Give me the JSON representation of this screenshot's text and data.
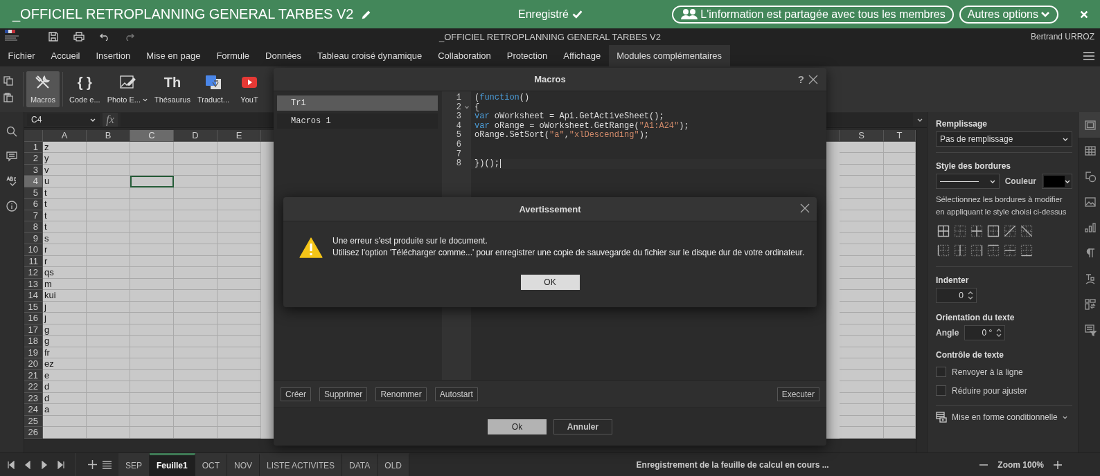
{
  "top_bar": {
    "title": "_OFFICIEL RETROPLANNING GENERAL TARBES V2",
    "status": "Enregistré",
    "share_button": "L'information est partagée avec tous les membres",
    "options_button": "Autres options"
  },
  "title_bar": {
    "title": "_OFFICIEL RETROPLANNING GENERAL TARBES V2",
    "user": "Bertrand URROZ"
  },
  "menu_tabs": [
    {
      "label": "Fichier",
      "selected": false
    },
    {
      "label": "Accueil",
      "selected": false
    },
    {
      "label": "Insertion",
      "selected": false
    },
    {
      "label": "Mise en page",
      "selected": false
    },
    {
      "label": "Formule",
      "selected": false
    },
    {
      "label": "Données",
      "selected": false
    },
    {
      "label": "Tableau croisé dynamique",
      "selected": false
    },
    {
      "label": "Collaboration",
      "selected": false
    },
    {
      "label": "Protection",
      "selected": false
    },
    {
      "label": "Affichage",
      "selected": false
    },
    {
      "label": "Modules complémentaires",
      "selected": true
    }
  ],
  "ribbon": [
    {
      "label": "Macros",
      "kind": "tools",
      "selected": true,
      "dropdown": false
    },
    {
      "label": "Code e...",
      "kind": "glyph",
      "glyph": "{ }",
      "selected": false,
      "dropdown": false
    },
    {
      "label": "Photo E...",
      "kind": "photo",
      "selected": false,
      "dropdown": true
    },
    {
      "label": "Thésaurus",
      "kind": "glyph",
      "glyph": "Th",
      "selected": false,
      "dropdown": false
    },
    {
      "label": "Traduct...",
      "kind": "translate",
      "selected": false,
      "dropdown": false
    },
    {
      "label": "YouT",
      "kind": "video",
      "selected": false,
      "dropdown": false
    }
  ],
  "formula_bar": {
    "name_box": "C4",
    "function_glyph": "fx"
  },
  "sheet": {
    "columns_left": [
      {
        "label": "A",
        "selected": false
      },
      {
        "label": "B",
        "selected": false
      },
      {
        "label": "C",
        "selected": true
      },
      {
        "label": "D",
        "selected": false
      },
      {
        "label": "E",
        "selected": false
      }
    ],
    "columns_right": [
      {
        "label": "S",
        "selected": false
      },
      {
        "label": "T",
        "selected": false
      }
    ],
    "rows": [
      {
        "number": "1",
        "selected": false,
        "cells": [
          "z"
        ]
      },
      {
        "number": "2",
        "selected": false,
        "cells": [
          "y"
        ]
      },
      {
        "number": "3",
        "selected": false,
        "cells": [
          "v"
        ]
      },
      {
        "number": "4",
        "selected": true,
        "cells": [
          "u"
        ]
      },
      {
        "number": "5",
        "selected": false,
        "cells": [
          "t"
        ]
      },
      {
        "number": "6",
        "selected": false,
        "cells": [
          "t"
        ]
      },
      {
        "number": "7",
        "selected": false,
        "cells": [
          "t"
        ]
      },
      {
        "number": "8",
        "selected": false,
        "cells": [
          "t"
        ]
      },
      {
        "number": "9",
        "selected": false,
        "cells": [
          "s"
        ]
      },
      {
        "number": "10",
        "selected": false,
        "cells": [
          "r"
        ]
      },
      {
        "number": "11",
        "selected": false,
        "cells": [
          "r"
        ]
      },
      {
        "number": "12",
        "selected": false,
        "cells": [
          "qs"
        ]
      },
      {
        "number": "13",
        "selected": false,
        "cells": [
          "m"
        ]
      },
      {
        "number": "14",
        "selected": false,
        "cells": [
          "kui"
        ]
      },
      {
        "number": "15",
        "selected": false,
        "cells": [
          "j"
        ]
      },
      {
        "number": "16",
        "selected": false,
        "cells": [
          "j"
        ]
      },
      {
        "number": "17",
        "selected": false,
        "cells": [
          "g"
        ]
      },
      {
        "number": "18",
        "selected": false,
        "cells": [
          "g"
        ]
      },
      {
        "number": "19",
        "selected": false,
        "cells": [
          "fr"
        ]
      },
      {
        "number": "20",
        "selected": false,
        "cells": [
          "ez"
        ]
      },
      {
        "number": "21",
        "selected": false,
        "cells": [
          "e"
        ]
      },
      {
        "number": "22",
        "selected": false,
        "cells": [
          "d"
        ]
      },
      {
        "number": "23",
        "selected": false,
        "cells": [
          "d"
        ]
      },
      {
        "number": "24",
        "selected": false,
        "cells": [
          "a"
        ]
      },
      {
        "number": "25",
        "selected": false
      },
      {
        "number": "26",
        "selected": false
      }
    ]
  },
  "sheet_tabs": [
    {
      "label": "SEP",
      "selected": false
    },
    {
      "label": "Feuille1",
      "selected": true
    },
    {
      "label": "OCT",
      "selected": false
    },
    {
      "label": "NOV",
      "selected": false
    },
    {
      "label": "LISTE ACTIVITES",
      "selected": false
    },
    {
      "label": "DATA",
      "selected": false
    },
    {
      "label": "OLD",
      "selected": false
    }
  ],
  "status": "Enregistrement de la feuille de calcul en cours ...",
  "zoom": "Zoom 100%",
  "right_panel": {
    "fill_label": "Remplissage",
    "fill_value": "Pas de remplissage",
    "border_style_label": "Style des bordures",
    "color_label": "Couleur",
    "border_hint": "Sélectionnez les bordures à modifier en appliquant le style choisi ci-dessus",
    "border_buttons": [
      {
        "kind": "all"
      },
      {
        "kind": "none"
      },
      {
        "kind": "inner"
      },
      {
        "kind": "outer"
      },
      {
        "kind": "diag-up"
      },
      {
        "kind": "diag-down"
      },
      {
        "kind": "left"
      },
      {
        "kind": "vertical"
      },
      {
        "kind": "right"
      },
      {
        "kind": "top"
      },
      {
        "kind": "horizontal"
      },
      {
        "kind": "bottom"
      }
    ],
    "indent_label": "Indenter",
    "indent_value": "0",
    "orientation_label": "Orientation du texte",
    "angle_label": "Angle",
    "angle_value": "0 °",
    "text_control_label": "Contrôle de texte",
    "checkboxes": [
      {
        "label": "Renvoyer à la ligne",
        "checked": false
      },
      {
        "label": "Réduire pour ajuster",
        "checked": false
      }
    ],
    "conditional_format": "Mise en forme conditionnelle"
  },
  "right_toolbar": [
    {
      "kind": "cell",
      "selected": true
    },
    {
      "kind": "table",
      "selected": false
    },
    {
      "kind": "shape",
      "selected": false
    },
    {
      "kind": "image",
      "selected": false
    },
    {
      "kind": "chart",
      "selected": false
    },
    {
      "kind": "paragraph",
      "selected": false
    },
    {
      "kind": "text-art",
      "selected": false
    },
    {
      "kind": "pivot",
      "selected": false
    },
    {
      "kind": "filter",
      "selected": false
    }
  ],
  "macros_dialog": {
    "title": "Macros",
    "help": "?",
    "list": [
      {
        "label": "Tri",
        "selected": true
      },
      {
        "label": "Macros 1",
        "selected": false
      }
    ],
    "code": [
      {
        "number": "1",
        "foldable": false,
        "active": false,
        "tokens": [
          {
            "text": "(",
            "kind": "plain"
          },
          {
            "text": "function",
            "kind": "keyword"
          },
          {
            "text": "()",
            "kind": "plain"
          }
        ]
      },
      {
        "number": "2",
        "foldable": true,
        "active": false,
        "tokens": [
          {
            "text": "{",
            "kind": "plain"
          }
        ]
      },
      {
        "number": "3",
        "foldable": false,
        "active": false,
        "tokens": [
          {
            "text": "var",
            "kind": "keyword"
          },
          {
            "text": " oWorksheet = Api.GetActiveSheet();",
            "kind": "plain"
          }
        ]
      },
      {
        "number": "4",
        "foldable": false,
        "active": false,
        "tokens": [
          {
            "text": "var",
            "kind": "keyword"
          },
          {
            "text": " oRange = oWorksheet.GetRange(",
            "kind": "plain"
          },
          {
            "text": "\"A1:A24\"",
            "kind": "string"
          },
          {
            "text": ");",
            "kind": "plain"
          }
        ]
      },
      {
        "number": "5",
        "foldable": false,
        "active": false,
        "tokens": [
          {
            "text": "oRange.SetSort(",
            "kind": "plain"
          },
          {
            "text": "\"a\"",
            "kind": "string"
          },
          {
            "text": ",",
            "kind": "plain"
          },
          {
            "text": "\"xlDescending\"",
            "kind": "string"
          },
          {
            "text": ");",
            "kind": "plain"
          }
        ]
      },
      {
        "number": "6",
        "foldable": false,
        "active": false
      },
      {
        "number": "7",
        "foldable": false,
        "active": false
      },
      {
        "number": "8",
        "foldable": false,
        "active": true,
        "tokens": [
          {
            "text": "})();",
            "kind": "plain"
          }
        ]
      }
    ],
    "actions": [
      "Créer",
      "Supprimer",
      "Renommer",
      "Autostart"
    ],
    "run_button": "Executer",
    "ok_button": "Ok",
    "cancel_button": "Annuler"
  },
  "warning_dialog": {
    "title": "Avertissement",
    "lines": [
      "Une erreur s'est produite sur le document.",
      "Utilisez l'option 'Télécharger comme...' pour enregistrer une copie de sauvegarde du fichier sur le disque dur de votre ordinateur."
    ],
    "ok_button": "OK"
  }
}
